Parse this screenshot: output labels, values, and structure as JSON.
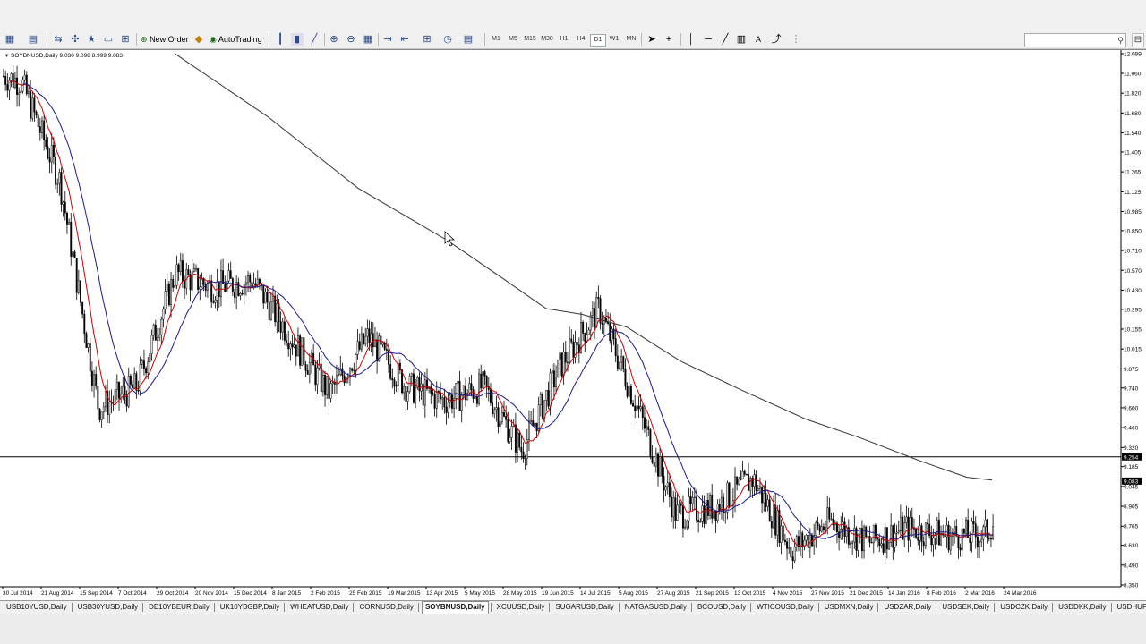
{
  "toolbar": {
    "new_order_label": "New Order",
    "autotrading_label": "AutoTrading",
    "timeframes": [
      "M1",
      "M5",
      "M15",
      "M30",
      "H1",
      "H4",
      "D1",
      "W1",
      "MN"
    ],
    "active_timeframe": "D1"
  },
  "chart": {
    "header": "SOYBNUSD,Daily  9.030 9.098 8.999 9.083",
    "horizontal_line_label": "9.254",
    "current_price_label": "9.083"
  },
  "chart_data": {
    "type": "candlestick",
    "symbol": "SOYBNUSD",
    "timeframe": "Daily",
    "ohlc_last": {
      "open": 9.03,
      "high": 9.098,
      "low": 8.999,
      "close": 9.083
    },
    "y_ticks": [
      "12.099",
      "11.960",
      "11.820",
      "11.680",
      "11.540",
      "11.405",
      "11.265",
      "11.125",
      "10.985",
      "10.850",
      "10.710",
      "10.570",
      "10.430",
      "10.295",
      "10.155",
      "10.015",
      "9.875",
      "9.740",
      "9.600",
      "9.460",
      "9.320",
      "9.185",
      "9.045",
      "8.905",
      "8.765",
      "8.630",
      "8.490",
      "8.350"
    ],
    "ylim": [
      8.35,
      12.099
    ],
    "x_ticks": [
      "30 Jul 2014",
      "21 Aug 2014",
      "15 Sep 2014",
      "7 Oct 2014",
      "29 Oct 2014",
      "20 Nov 2014",
      "15 Dec 2014",
      "8 Jan 2015",
      "2 Feb 2015",
      "25 Feb 2015",
      "19 Mar 2015",
      "13 Apr 2015",
      "5 May 2015",
      "28 May 2015",
      "19 Jun 2015",
      "14 Jul 2015",
      "5 Aug 2015",
      "27 Aug 2015",
      "21 Sep 2015",
      "13 Oct 2015",
      "4 Nov 2015",
      "27 Nov 2015",
      "21 Dec 2015",
      "14 Jan 2016",
      "8 Feb 2016",
      "2 Mar 2016",
      "24 Mar 2016"
    ],
    "horizontal_line": 9.254,
    "close_path": [
      [
        "30 Jul 2014",
        11.9
      ],
      [
        "21 Aug 2014",
        11.2
      ],
      [
        "15 Sep 2014",
        9.6
      ],
      [
        "7 Oct 2014",
        9.75
      ],
      [
        "29 Oct 2014",
        10.55
      ],
      [
        "20 Nov 2014",
        10.45
      ],
      [
        "15 Dec 2014",
        10.5
      ],
      [
        "8 Jan 2015",
        10.1
      ],
      [
        "2 Feb 2015",
        9.7
      ],
      [
        "25 Feb 2015",
        10.1
      ],
      [
        "19 Mar 2015",
        9.75
      ],
      [
        "13 Apr 2015",
        9.65
      ],
      [
        "5 May 2015",
        9.75
      ],
      [
        "28 May 2015",
        9.3
      ],
      [
        "19 Jun 2015",
        9.9
      ],
      [
        "14 Jul 2015",
        10.3
      ],
      [
        "5 Aug 2015",
        9.6
      ],
      [
        "27 Aug 2015",
        8.85
      ],
      [
        "21 Sep 2015",
        8.9
      ],
      [
        "13 Oct 2015",
        9.1
      ],
      [
        "4 Nov 2015",
        8.6
      ],
      [
        "27 Nov 2015",
        8.8
      ],
      [
        "21 Dec 2015",
        8.65
      ],
      [
        "14 Jan 2016",
        8.75
      ],
      [
        "8 Feb 2016",
        8.7
      ],
      [
        "2 Mar 2016",
        8.7
      ],
      [
        "24 Mar 2016",
        9.08
      ]
    ],
    "series": [
      {
        "type": "moving-average",
        "color": "#cc0000"
      },
      {
        "type": "moving-average",
        "color": "#1a1a8a"
      },
      {
        "type": "moving-average",
        "color": "#333333"
      }
    ]
  },
  "symbol_tabs": [
    "USB10YUSD,Daily",
    "USB30YUSD,Daily",
    "DE10YBEUR,Daily",
    "UK10YBGBP,Daily",
    "WHEATUSD,Daily",
    "CORNUSD,Daily",
    "SOYBNUSD,Daily",
    "XCUUSD,Daily",
    "SUGARUSD,Daily",
    "NATGASUSD,Daily",
    "BCOUSD,Daily",
    "WTICOUSD,Daily",
    "USDMXN,Daily",
    "USDZAR,Daily",
    "USDSEK,Daily",
    "USDCZK,Daily",
    "USDDKK,Daily",
    "USDHUF,Wi"
  ],
  "active_tab": "SOYBNUSD,Daily",
  "colors": {
    "candle": "#000000",
    "ma_fast": "#cc0000",
    "ma_mid": "#1a1a8a",
    "ma_slow": "#333333",
    "price_label_bg": "#000000"
  }
}
